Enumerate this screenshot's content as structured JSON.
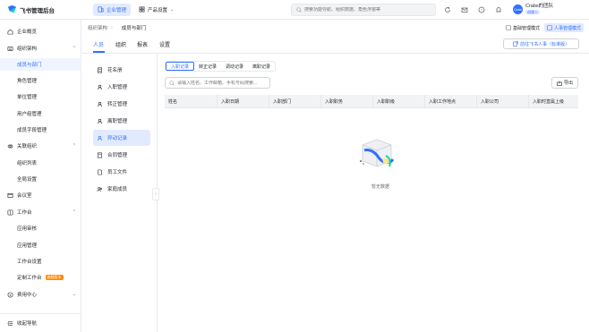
{
  "header": {
    "app_name": "飞书管理后台",
    "nav": [
      {
        "label": "企业管理",
        "icon": "building-icon",
        "active": true
      },
      {
        "label": "产品设置",
        "icon": "grid-icon",
        "active": false
      }
    ],
    "search_placeholder": "搜索功能导航、组织数据、角色浮窗等",
    "icons": [
      "refresh-icon",
      "mail-icon",
      "help-icon",
      "bell-icon"
    ],
    "user": {
      "avatar_text": "Crab",
      "name": "Crabs的团队",
      "badge": "创建人"
    }
  },
  "sidebar": {
    "items": [
      {
        "label": "企业概览",
        "icon": "home-icon",
        "type": "group"
      },
      {
        "label": "组织架构",
        "icon": "org-icon",
        "type": "group",
        "expanded": true
      },
      {
        "label": "成员与部门",
        "type": "sub",
        "active": true
      },
      {
        "label": "角色管理",
        "type": "sub"
      },
      {
        "label": "单位管理",
        "type": "sub"
      },
      {
        "label": "用户组管理",
        "type": "sub"
      },
      {
        "label": "成员字段管理",
        "type": "sub"
      },
      {
        "label": "关联组织",
        "icon": "link-icon",
        "type": "group",
        "expanded": true
      },
      {
        "label": "组织列表",
        "type": "sub"
      },
      {
        "label": "全局设置",
        "type": "sub"
      },
      {
        "label": "会议室",
        "icon": "meeting-icon",
        "type": "group"
      },
      {
        "label": "工作台",
        "icon": "workspace-icon",
        "type": "group",
        "expanded": true
      },
      {
        "label": "应用审核",
        "type": "sub"
      },
      {
        "label": "应用管理",
        "type": "sub"
      },
      {
        "label": "工作台设置",
        "type": "sub"
      },
      {
        "label": "定制工作台",
        "type": "sub",
        "badge": "旗舰版本"
      },
      {
        "label": "费用中心",
        "icon": "fee-icon",
        "type": "group"
      }
    ],
    "collapse_label": "收起导航"
  },
  "breadcrumb": [
    "组织架构",
    "成员与部门"
  ],
  "modes": [
    {
      "label": "基础管理模式",
      "active": false
    },
    {
      "label": "人事管理模式",
      "active": true
    }
  ],
  "tabs": [
    "人员",
    "组织",
    "报表",
    "设置"
  ],
  "feishu_button": "前往飞书人事（标准版）",
  "secondary_menu": [
    {
      "label": "花名册",
      "icon": "roster-icon"
    },
    {
      "label": "入职管理",
      "icon": "onboard-icon"
    },
    {
      "label": "转正管理",
      "icon": "confirm-icon"
    },
    {
      "label": "离职管理",
      "icon": "offboard-icon"
    },
    {
      "label": "异动记录",
      "icon": "change-icon",
      "active": true
    },
    {
      "label": "合同管理",
      "icon": "contract-icon"
    },
    {
      "label": "员工文件",
      "icon": "file-icon"
    },
    {
      "label": "家庭成员",
      "icon": "family-icon"
    }
  ],
  "record_tabs": [
    "入职记录",
    "转正记录",
    "调动记录",
    "离职记录"
  ],
  "content_search_placeholder": "请输入姓名、工作邮箱、手机号码搜索...",
  "export_label": "导出",
  "table_columns": [
    "姓名",
    "入职日期",
    "入职部门",
    "入职职务",
    "入职职级",
    "入职工作地点",
    "入职公司",
    "入职时直属上级"
  ],
  "empty_text": "暂无数据",
  "colors": {
    "accent": "#3370ff",
    "accent_bg": "#e1eaff",
    "badge": "#ff8800"
  }
}
